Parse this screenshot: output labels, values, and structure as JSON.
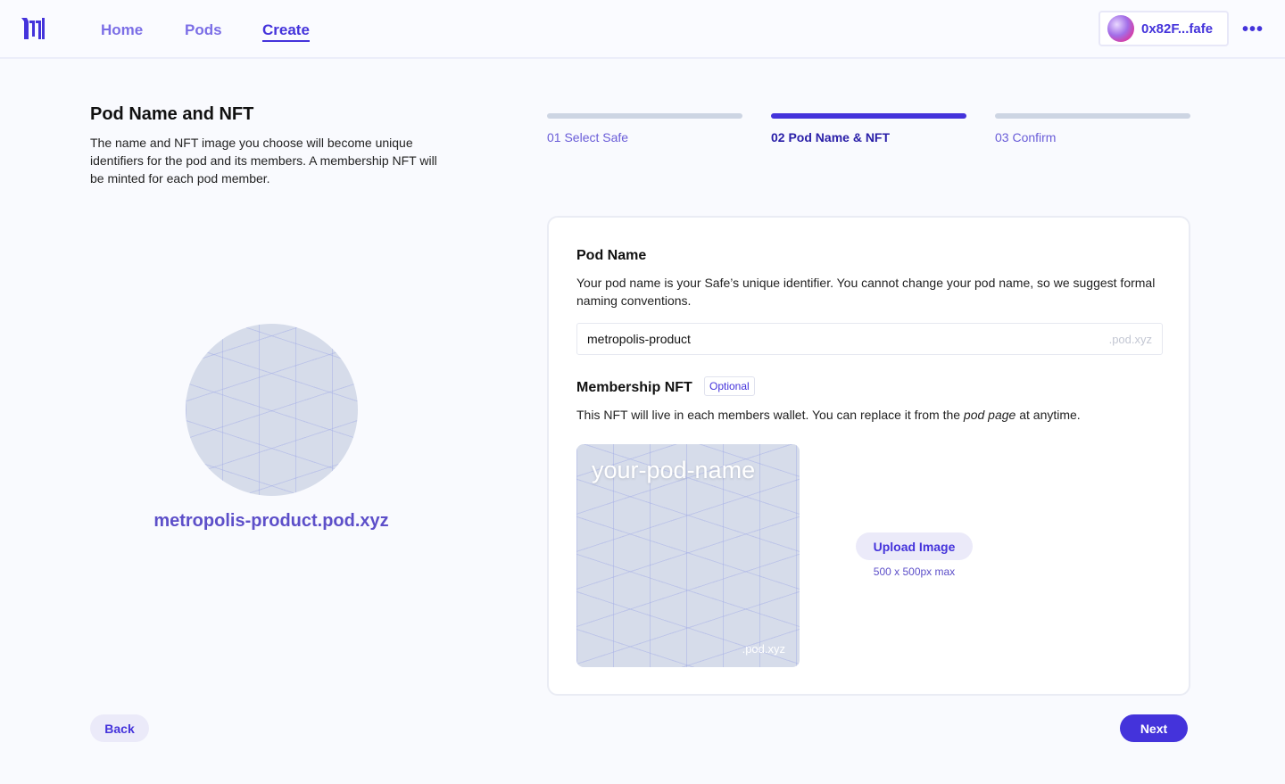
{
  "nav": {
    "links": [
      "Home",
      "Pods",
      "Create"
    ],
    "active": "Create",
    "wallet": "0x82F...fafe",
    "more_icon": "ellipsis-icon"
  },
  "intro": {
    "title": "Pod Name and NFT",
    "text": "The name and NFT image you choose will become unique identifiers for the pod and its members. A membership NFT will be minted for each pod member.",
    "pod_url": "metropolis-product.pod.xyz"
  },
  "steps": [
    {
      "label": "01 Select Safe"
    },
    {
      "label": "02 Pod Name & NFT",
      "active": true
    },
    {
      "label": "03 Confirm"
    }
  ],
  "form": {
    "pod_name_title": "Pod Name",
    "pod_name_desc": "Your pod name is your Safe’s unique identifier. You cannot change your pod name, so we suggest formal naming conventions.",
    "pod_name_value": "metropolis-product",
    "pod_name_suffix": ".pod.xyz",
    "nft_title": "Membership NFT",
    "nft_badge": "Optional",
    "nft_desc_pre": "This NFT will live in each members wallet. You can replace it from the ",
    "nft_desc_em": "pod page",
    "nft_desc_post": " at anytime.",
    "nft_preview_name": "your-pod-name",
    "nft_preview_suffix": ".pod.xyz",
    "upload_label": "Upload Image",
    "upload_hint": "500 x 500px max"
  },
  "footer": {
    "back": "Back",
    "next": "Next"
  },
  "colors": {
    "accent": "#4433db",
    "background": "#f9fafe"
  }
}
